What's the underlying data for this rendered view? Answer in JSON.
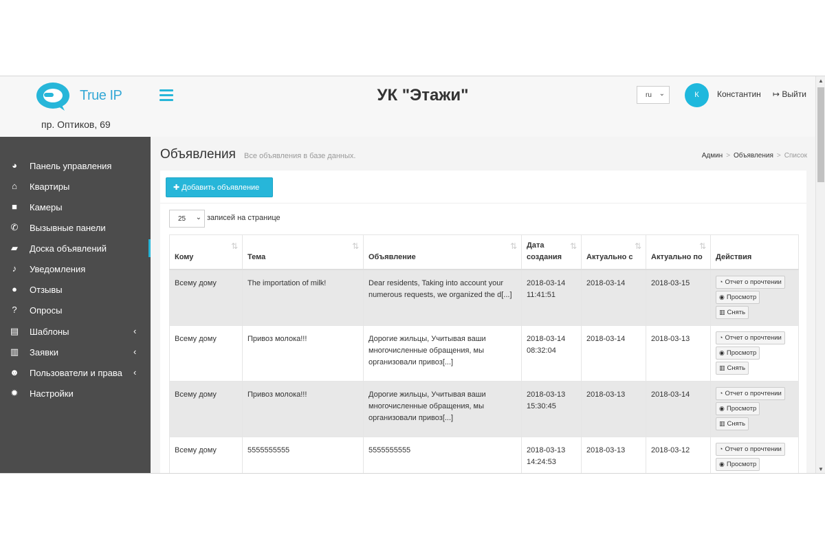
{
  "header": {
    "logo_text": "True IP",
    "address": "пр. Оптиков, 69",
    "title": "УК \"Этажи\"",
    "language": "ru",
    "avatar_letter": "К",
    "username": "Константин",
    "logout_label": "Выйти"
  },
  "sidebar": {
    "items": [
      {
        "label": "Панель управления",
        "icon": "dashboard-icon",
        "glyph": "◕"
      },
      {
        "label": "Квартиры",
        "icon": "home-icon",
        "glyph": "⌂"
      },
      {
        "label": "Камеры",
        "icon": "video-camera-icon",
        "glyph": "■"
      },
      {
        "label": "Вызывные панели",
        "icon": "phone-icon",
        "glyph": "✆"
      },
      {
        "label": "Доска объявлений",
        "icon": "sticky-note-icon",
        "glyph": "▰"
      },
      {
        "label": "Уведомления",
        "icon": "bell-icon",
        "glyph": "♪"
      },
      {
        "label": "Отзывы",
        "icon": "comment-icon",
        "glyph": "●"
      },
      {
        "label": "Опросы",
        "icon": "question-icon",
        "glyph": "?"
      },
      {
        "label": "Шаблоны",
        "icon": "files-icon",
        "glyph": "▤"
      },
      {
        "label": "Заявки",
        "icon": "file-text-icon",
        "glyph": "▥"
      },
      {
        "label": "Пользователи и права",
        "icon": "users-icon",
        "glyph": "☻"
      },
      {
        "label": "Настройки",
        "icon": "gear-icon",
        "glyph": "✹"
      }
    ],
    "active_index": 4
  },
  "content": {
    "title": "Объявления",
    "subtitle": "Все объявления в базе данных.",
    "breadcrumb": [
      "Админ",
      "Объявления",
      "Список"
    ],
    "add_button": "Добавить объявление",
    "page_length": "25",
    "page_length_label": "записей на странице"
  },
  "table": {
    "headers": {
      "to": "Кому",
      "subject": "Тема",
      "body": "Объявление",
      "created": "Дата создания",
      "from": "Актуально с",
      "until": "Актуально по",
      "actions": "Действия"
    },
    "action_labels": {
      "report": "Отчет о прочтении",
      "view": "Просмотр",
      "remove": "Снять"
    },
    "rows": [
      {
        "to": "Всему дому",
        "subject": "The importation of milk!",
        "body": "Dear residents, Taking into account your numerous requests, we organized the d[...]",
        "created": "2018-03-14 11:41:51",
        "from": "2018-03-14",
        "until": "2018-03-15"
      },
      {
        "to": "Всему дому",
        "subject": "Привоз молока!!!",
        "body": "Дорогие жильцы, Учитывая ваши многочисленные обращения, мы организовали привоз[...]",
        "created": "2018-03-14 08:32:04",
        "from": "2018-03-14",
        "until": "2018-03-13"
      },
      {
        "to": "Всему дому",
        "subject": "Привоз молока!!!",
        "body": "Дорогие жильцы, Учитывая ваши многочисленные обращения, мы организовали привоз[...]",
        "created": "2018-03-13 15:30:45",
        "from": "2018-03-13",
        "until": "2018-03-14"
      },
      {
        "to": "Всему дому",
        "subject": "5555555555",
        "body": "5555555555",
        "created": "2018-03-13 14:24:53",
        "from": "2018-03-13",
        "until": "2018-03-12"
      }
    ]
  },
  "colors": {
    "accent": "#27b6d9",
    "sidebar_bg": "#4c4c4c",
    "row_stripe": "#e8e8e8"
  }
}
